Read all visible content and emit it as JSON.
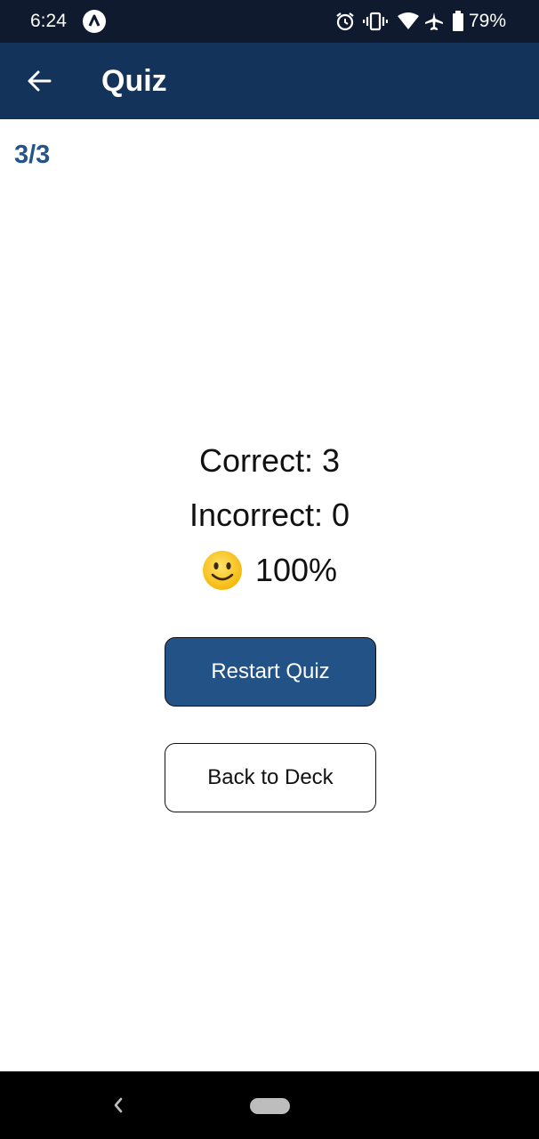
{
  "status_bar": {
    "time": "6:24",
    "battery": "79%",
    "icons": [
      "app-notification-icon",
      "alarm-icon",
      "vibrate-icon",
      "wifi-icon",
      "airplane-mode-icon",
      "battery-icon"
    ]
  },
  "app_bar": {
    "title": "Quiz",
    "back_icon": "arrow-left-icon",
    "background": "#14335a"
  },
  "progress": "3/3",
  "results": {
    "correct": "Correct: 3",
    "incorrect": "Incorrect: 0",
    "score_icon": "smiley-icon",
    "score": "100%"
  },
  "buttons": {
    "restart": "Restart Quiz",
    "back_to_deck": "Back to Deck"
  },
  "nav_bar": {
    "icons": [
      "nav-back-icon",
      "nav-home-pill"
    ]
  },
  "colors": {
    "accent": "#225286",
    "progress_text": "#24548a",
    "status_bar": "#0f1a2e"
  }
}
